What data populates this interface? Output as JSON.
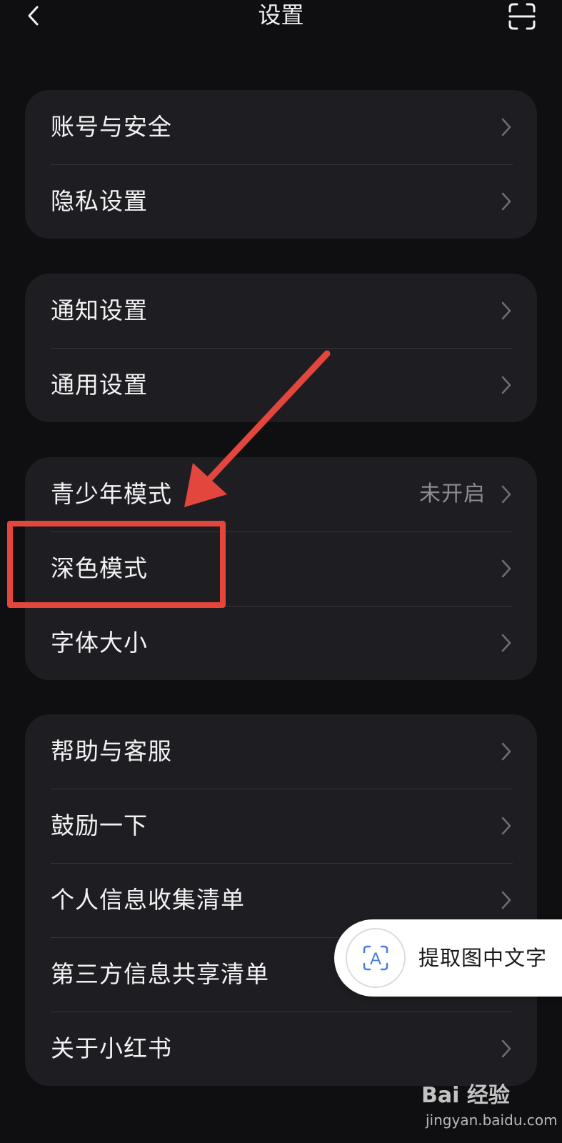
{
  "header": {
    "title": "设置",
    "back_icon": "chevron-left-icon",
    "scan_icon": "scan-icon"
  },
  "groups": [
    {
      "items": [
        {
          "label": "账号与安全",
          "value": ""
        },
        {
          "label": "隐私设置",
          "value": ""
        }
      ]
    },
    {
      "items": [
        {
          "label": "通知设置",
          "value": ""
        },
        {
          "label": "通用设置",
          "value": ""
        }
      ]
    },
    {
      "items": [
        {
          "label": "青少年模式",
          "value": "未开启"
        },
        {
          "label": "深色模式",
          "value": ""
        },
        {
          "label": "字体大小",
          "value": ""
        }
      ]
    },
    {
      "items": [
        {
          "label": "帮助与客服",
          "value": ""
        },
        {
          "label": "鼓励一下",
          "value": ""
        },
        {
          "label": "个人信息收集清单",
          "value": ""
        },
        {
          "label": "第三方信息共享清单",
          "value": ""
        },
        {
          "label": "关于小红书",
          "value": ""
        }
      ]
    }
  ],
  "ocr_button": {
    "label": "提取图中文字",
    "icon": "text-recognition-icon",
    "icon_letter": "A"
  },
  "watermark": {
    "brand": "Bai 经验",
    "url": "jingyan.baidu.com"
  },
  "colors": {
    "background": "#0f0f11",
    "card": "#1e1e22",
    "annotation_red": "#e3463c",
    "ocr_accent": "#4a7be0"
  }
}
